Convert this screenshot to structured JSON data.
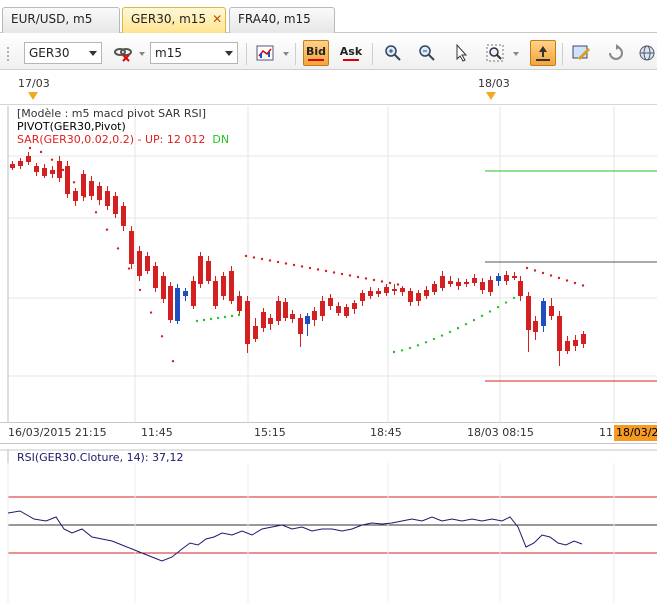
{
  "tabs": [
    {
      "label": "EUR/USD, m5",
      "active": false
    },
    {
      "label": "GER30, m15",
      "active": true,
      "close": "✕"
    },
    {
      "label": "FRA40, m15",
      "active": false
    }
  ],
  "toolbar": {
    "symbol": "GER30",
    "timeframe": "m15",
    "bid_label": "Bid",
    "ask_label": "Ask"
  },
  "date_strip": {
    "labels": [
      "17/03",
      "18/03"
    ]
  },
  "legend": {
    "model": "[Modèle : m5 macd pivot SAR RSI]",
    "pivot": "PIVOT(GER30,Pivot)",
    "sar": "SAR(GER30,0.02,0.2) -  UP: 12 012",
    "sar_dn": "DN"
  },
  "time_axis": {
    "labels": [
      "16/03/2015 21:15",
      "11:45",
      "15:15",
      "18:45",
      "18/03 08:15",
      "11"
    ],
    "cursor": "18/03/2"
  },
  "rsi": {
    "legend": "RSI(GER30.Cloture, 14): 37,12"
  },
  "colors": {
    "bull": "#1f4fbf",
    "bear": "#d42020",
    "sar_up": "#22c422",
    "sar_dn": "#d42020",
    "rsi_line": "#1a1a6e",
    "cursor_bg": "#f59a23",
    "active_tab": "#ffe58f"
  }
}
